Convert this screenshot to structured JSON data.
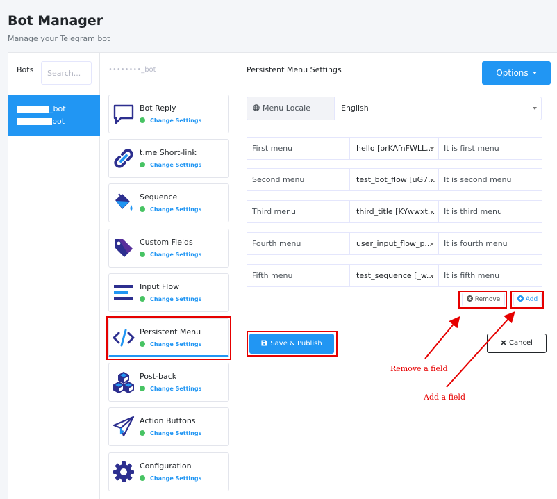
{
  "header": {
    "title": "Bot Manager",
    "subtitle": "Manage your Telegram bot"
  },
  "bots": {
    "label": "Bots",
    "search_placeholder": "Search...",
    "items": [
      {
        "line1": "_bot",
        "line2": "bot"
      }
    ]
  },
  "bot_name": "••••••••_bot",
  "features": [
    {
      "name": "Bot Reply",
      "icon": "chat-bubble-icon",
      "status": "Change Settings"
    },
    {
      "name": "t.me Short-link",
      "icon": "link-icon",
      "status": "Change Settings"
    },
    {
      "name": "Sequence",
      "icon": "paint-bucket-icon",
      "status": "Change Settings"
    },
    {
      "name": "Custom Fields",
      "icon": "tag-icon",
      "status": "Change Settings"
    },
    {
      "name": "Input Flow",
      "icon": "align-left-icon",
      "status": "Change Settings"
    },
    {
      "name": "Persistent Menu",
      "icon": "code-icon",
      "status": "Change Settings"
    },
    {
      "name": "Post-back",
      "icon": "cubes-icon",
      "status": "Change Settings"
    },
    {
      "name": "Action Buttons",
      "icon": "paper-plane-icon",
      "status": "Change Settings"
    },
    {
      "name": "Configuration",
      "icon": "gear-icon",
      "status": "Change Settings"
    }
  ],
  "settings": {
    "title": "Persistent Menu Settings",
    "options_label": "Options",
    "locale_label": "Menu Locale",
    "locale_value": "English",
    "menus": [
      {
        "label": "First menu",
        "value": "hello [orKAfnFWLL...",
        "desc": "It is first menu"
      },
      {
        "label": "Second menu",
        "value": "test_bot_flow [uG7...",
        "desc": "It is second menu"
      },
      {
        "label": "Third menu",
        "value": "third_title [KYwwxt...",
        "desc": "It is third menu"
      },
      {
        "label": "Fourth menu",
        "value": "user_input_flow_p...",
        "desc": "It is fourth menu"
      },
      {
        "label": "Fifth menu",
        "value": "test_sequence [_w...",
        "desc": "It is fifth menu"
      }
    ],
    "remove_label": "Remove",
    "add_label": "Add",
    "save_label": "Save & Publish",
    "cancel_label": "Cancel"
  },
  "annotations": {
    "remove": "Remove a field",
    "add": "Add a field"
  },
  "colors": {
    "primary": "#2196f3",
    "success": "#47c363",
    "icon": "#2d2f8f",
    "annotation": "#e60000"
  }
}
